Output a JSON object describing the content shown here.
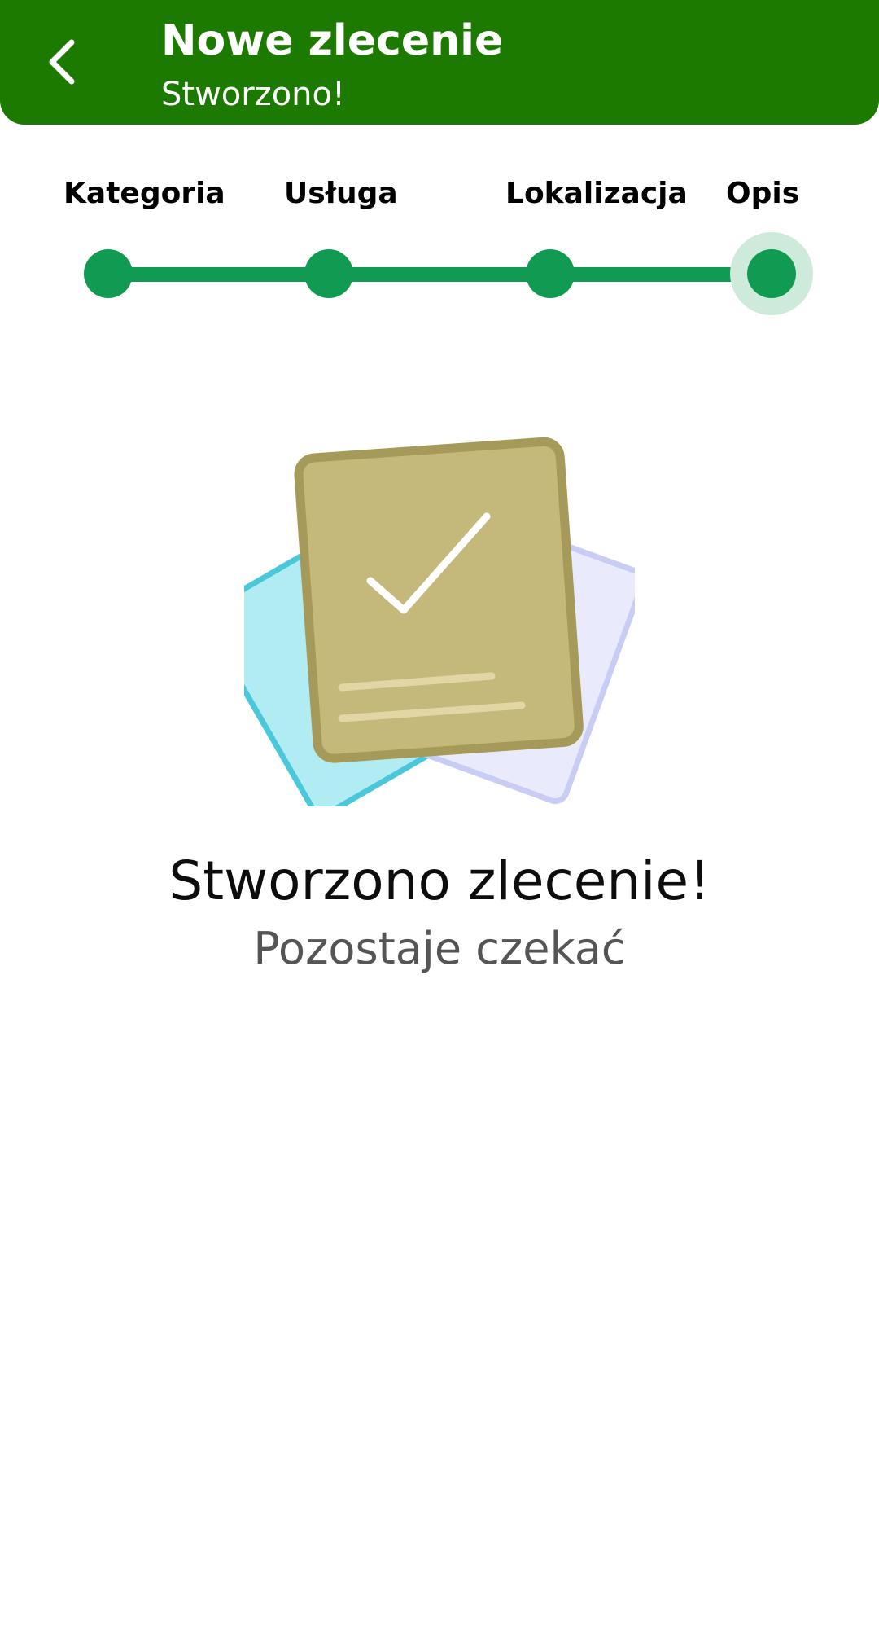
{
  "colors": {
    "header_bg": "#1c7a00",
    "accent": "#119a52",
    "halo": "#cdeadb"
  },
  "header": {
    "back_icon": "chevron-left-icon",
    "title": "Nowe zlecenie",
    "subtitle": "Stworzono!"
  },
  "stepper": {
    "steps": [
      {
        "label": "Kategoria",
        "completed": true
      },
      {
        "label": "Usługa",
        "completed": true
      },
      {
        "label": "Lokalizacja",
        "completed": true
      },
      {
        "label": "Opis",
        "completed": true,
        "current": true
      }
    ]
  },
  "illustration": {
    "icon": "document-check-icon"
  },
  "result": {
    "title": "Stworzono zlecenie!",
    "subtitle": "Pozostaje czekać"
  }
}
